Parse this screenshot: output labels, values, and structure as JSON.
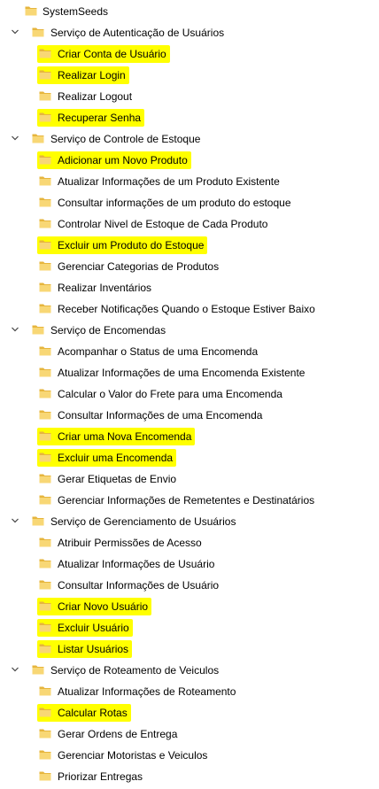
{
  "colors": {
    "highlight": "#ffff00",
    "folder_front": "#f8d775",
    "folder_back": "#e6b53d",
    "chevron": "#444444",
    "text": "#000000"
  },
  "tree": [
    {
      "label": "SystemSeeds",
      "level": 0,
      "expanded": null,
      "highlighted": false
    },
    {
      "label": "Serviço de Autenticação de Usuários",
      "level": 1,
      "expanded": true,
      "highlighted": false
    },
    {
      "label": "Criar Conta de Usuário",
      "level": 2,
      "expanded": null,
      "highlighted": true
    },
    {
      "label": "Realizar Login",
      "level": 2,
      "expanded": null,
      "highlighted": true
    },
    {
      "label": "Realizar Logout",
      "level": 2,
      "expanded": null,
      "highlighted": false
    },
    {
      "label": "Recuperar Senha",
      "level": 2,
      "expanded": null,
      "highlighted": true
    },
    {
      "label": "Serviço de Controle de Estoque",
      "level": 1,
      "expanded": true,
      "highlighted": false
    },
    {
      "label": "Adicionar um Novo Produto",
      "level": 2,
      "expanded": null,
      "highlighted": true
    },
    {
      "label": "Atualizar Informações de um Produto Existente",
      "level": 2,
      "expanded": null,
      "highlighted": false
    },
    {
      "label": "Consultar informações de um produto do estoque",
      "level": 2,
      "expanded": null,
      "highlighted": false
    },
    {
      "label": "Controlar Nivel de Estoque de Cada Produto",
      "level": 2,
      "expanded": null,
      "highlighted": false
    },
    {
      "label": "Excluir um Produto do Estoque",
      "level": 2,
      "expanded": null,
      "highlighted": true
    },
    {
      "label": "Gerenciar Categorias de Produtos",
      "level": 2,
      "expanded": null,
      "highlighted": false
    },
    {
      "label": "Realizar Inventários",
      "level": 2,
      "expanded": null,
      "highlighted": false
    },
    {
      "label": "Receber Notificações Quando o Estoque Estiver Baixo",
      "level": 2,
      "expanded": null,
      "highlighted": false
    },
    {
      "label": "Serviço de Encomendas",
      "level": 1,
      "expanded": true,
      "highlighted": false
    },
    {
      "label": "Acompanhar o Status de uma Encomenda",
      "level": 2,
      "expanded": null,
      "highlighted": false
    },
    {
      "label": "Atualizar Informações de uma Encomenda Existente",
      "level": 2,
      "expanded": null,
      "highlighted": false
    },
    {
      "label": "Calcular o Valor do Frete para uma Encomenda",
      "level": 2,
      "expanded": null,
      "highlighted": false
    },
    {
      "label": "Consultar Informações de uma Encomenda",
      "level": 2,
      "expanded": null,
      "highlighted": false
    },
    {
      "label": "Criar uma Nova Encomenda",
      "level": 2,
      "expanded": null,
      "highlighted": true
    },
    {
      "label": "Excluir uma Encomenda",
      "level": 2,
      "expanded": null,
      "highlighted": true
    },
    {
      "label": "Gerar Etiquetas de Envio",
      "level": 2,
      "expanded": null,
      "highlighted": false
    },
    {
      "label": "Gerenciar Informações de Remetentes e Destinatários",
      "level": 2,
      "expanded": null,
      "highlighted": false
    },
    {
      "label": "Serviço de Gerenciamento de Usuários",
      "level": 1,
      "expanded": true,
      "highlighted": false
    },
    {
      "label": "Atribuir Permissões de Acesso",
      "level": 2,
      "expanded": null,
      "highlighted": false
    },
    {
      "label": "Atualizar Informações de Usuário",
      "level": 2,
      "expanded": null,
      "highlighted": false
    },
    {
      "label": "Consultar Informações de Usuário",
      "level": 2,
      "expanded": null,
      "highlighted": false
    },
    {
      "label": "Criar Novo Usuário",
      "level": 2,
      "expanded": null,
      "highlighted": true
    },
    {
      "label": "Excluir Usuário",
      "level": 2,
      "expanded": null,
      "highlighted": true
    },
    {
      "label": "Listar Usuários",
      "level": 2,
      "expanded": null,
      "highlighted": true
    },
    {
      "label": "Serviço de Roteamento de Veiculos",
      "level": 1,
      "expanded": true,
      "highlighted": false
    },
    {
      "label": "Atualizar Informações de Roteamento",
      "level": 2,
      "expanded": null,
      "highlighted": false
    },
    {
      "label": "Calcular Rotas",
      "level": 2,
      "expanded": null,
      "highlighted": true
    },
    {
      "label": "Gerar Ordens de Entrega",
      "level": 2,
      "expanded": null,
      "highlighted": false
    },
    {
      "label": "Gerenciar Motoristas e Veiculos",
      "level": 2,
      "expanded": null,
      "highlighted": false
    },
    {
      "label": "Priorizar Entregas",
      "level": 2,
      "expanded": null,
      "highlighted": false
    }
  ]
}
